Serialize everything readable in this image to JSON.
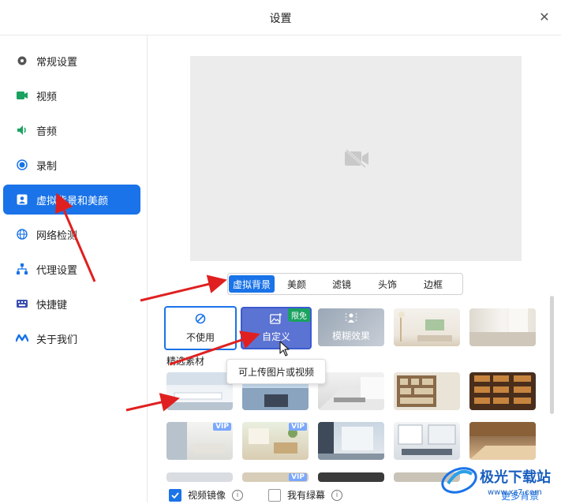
{
  "window": {
    "title": "设置",
    "close_icon": "close-icon"
  },
  "sidebar": {
    "items": [
      {
        "label": "常规设置",
        "icon": "gear-icon"
      },
      {
        "label": "视频",
        "icon": "video-icon"
      },
      {
        "label": "音频",
        "icon": "speaker-icon"
      },
      {
        "label": "录制",
        "icon": "record-icon"
      },
      {
        "label": "虚拟背景和美颜",
        "icon": "person-icon",
        "active": true
      },
      {
        "label": "网络检测",
        "icon": "globe-icon"
      },
      {
        "label": "代理设置",
        "icon": "network-icon"
      },
      {
        "label": "快捷键",
        "icon": "keyboard-icon"
      },
      {
        "label": "关于我们",
        "icon": "logo-icon"
      }
    ]
  },
  "tabs": [
    "虚拟背景",
    "美颜",
    "滤镜",
    "头饰",
    "边框"
  ],
  "options": {
    "none": "不使用",
    "custom": "自定义",
    "custom_badge": "限免",
    "blur": "模糊效果"
  },
  "tooltip": "可上传图片或视频",
  "section_label": "精选素材",
  "vip_label": "VIP",
  "bottom": {
    "mirror": "视频镜像",
    "greenscreen": "我有绿幕",
    "more": "更多背景"
  },
  "watermark": {
    "text": "极光下载站",
    "url": "www.xz7.com"
  },
  "colors": {
    "accent": "#1a73e8",
    "arrow": "#e02020"
  }
}
